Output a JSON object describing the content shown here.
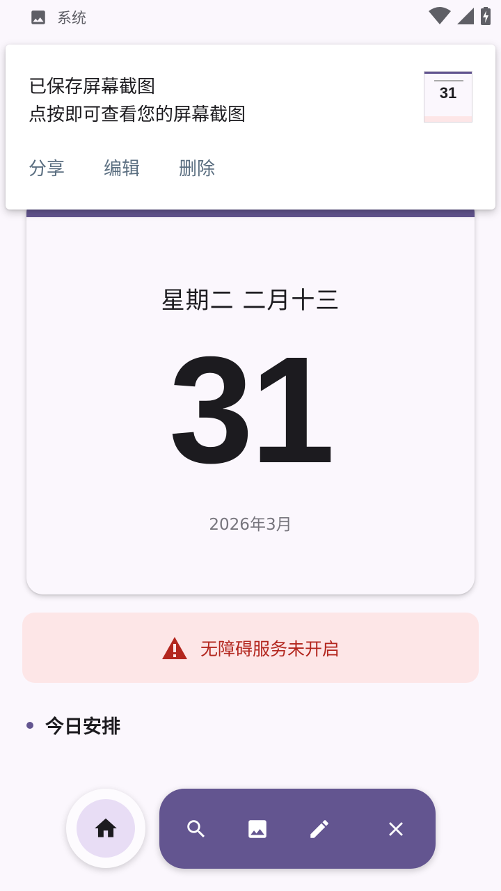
{
  "status_bar": {
    "app_label": "系统",
    "left_icon": "image-icon",
    "right_icons": [
      "wifi-icon",
      "cell-signal-icon",
      "battery-charging-icon"
    ]
  },
  "notification": {
    "title": "已保存屏幕截图",
    "text": "点按即可查看您的屏幕截图",
    "actions": {
      "share": "分享",
      "edit": "编辑",
      "delete": "删除"
    },
    "thumbnail_day": "31"
  },
  "calendar": {
    "lunar": "星期二 二月十三",
    "day": "31",
    "month": "2026年3月",
    "accent_color": "#635590"
  },
  "warning": {
    "icon": "warning-icon",
    "text": "无障碍服务未开启",
    "color": "#b3261e",
    "background": "#fde6e7"
  },
  "schedule": {
    "title": "今日安排"
  },
  "bottom_bar": {
    "home_icon": "home-icon",
    "tools": [
      "search-icon",
      "image-icon",
      "pencil-icon",
      "close-icon"
    ],
    "toolbar_color": "#635590"
  }
}
